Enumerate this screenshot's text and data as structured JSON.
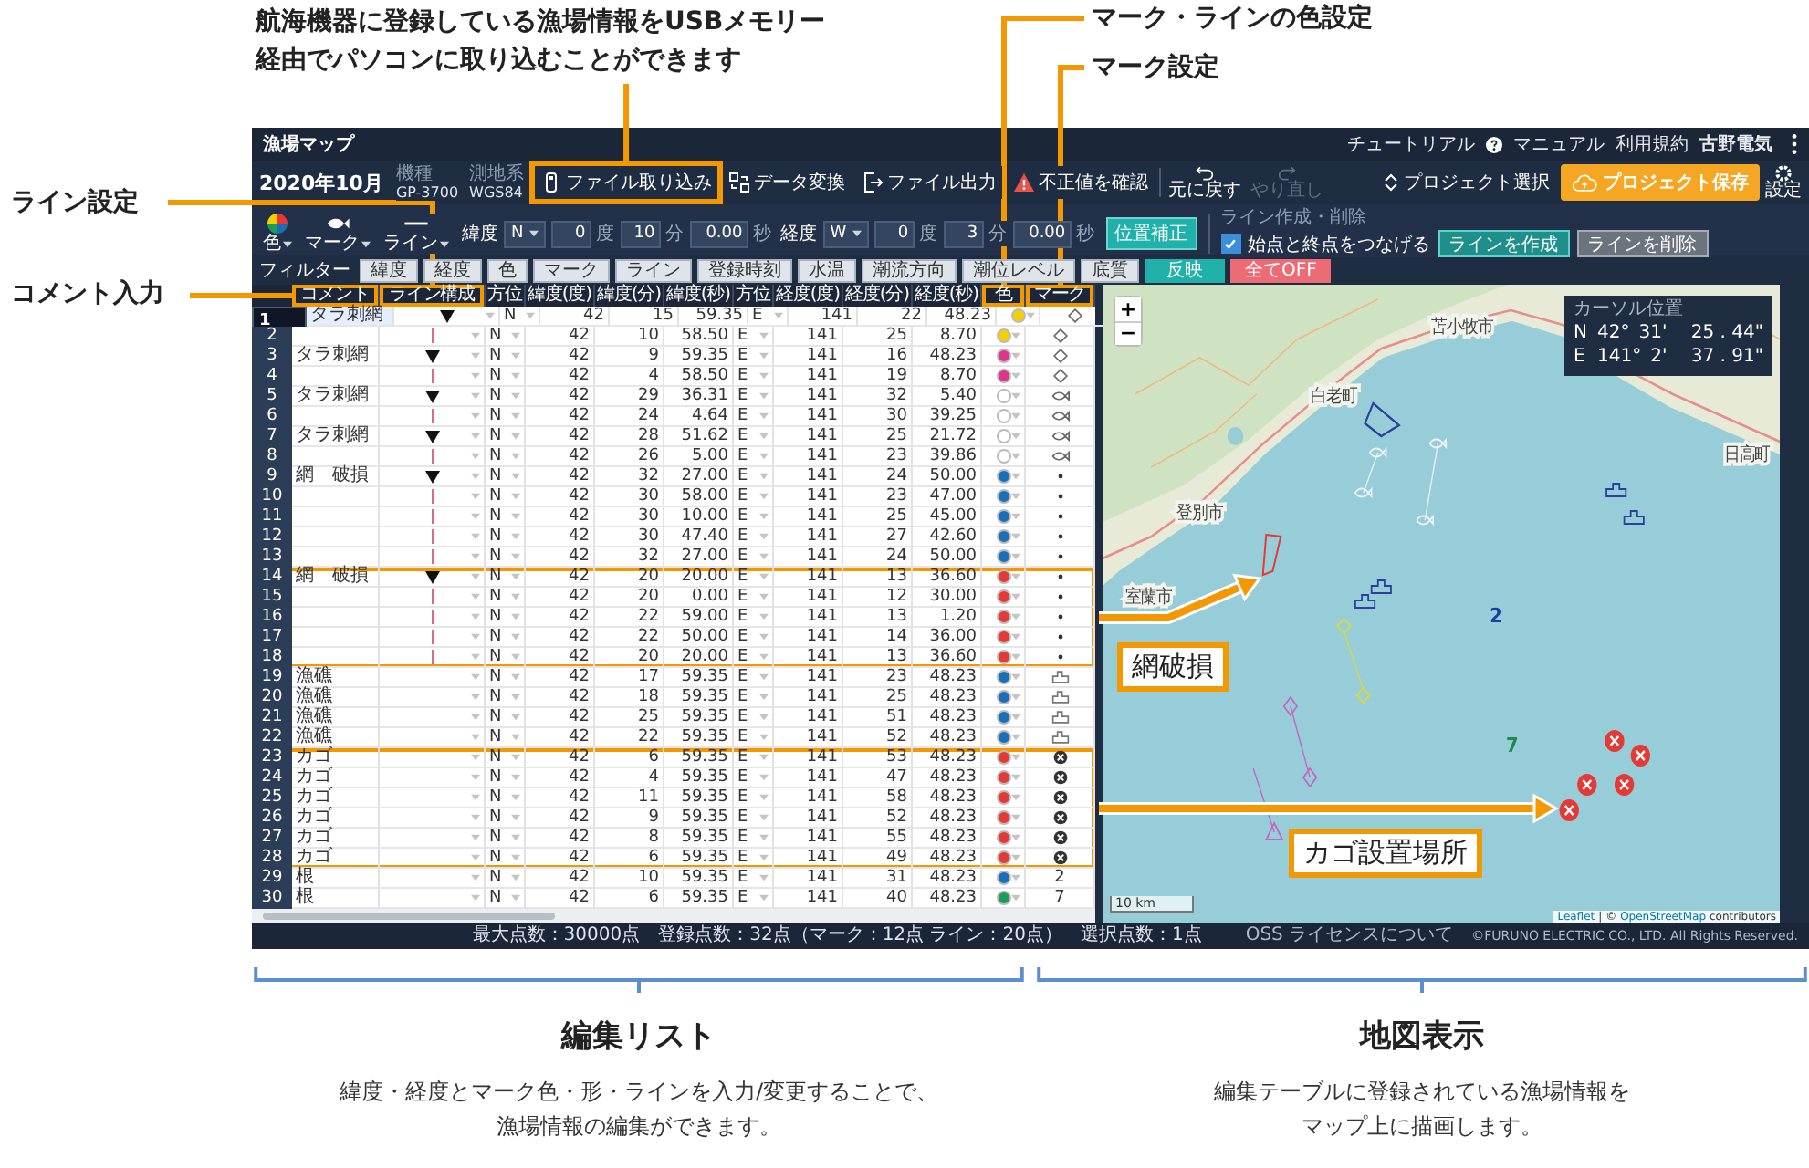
{
  "title_bar": {
    "title": "漁場マップ",
    "links": [
      {
        "label": "チュートリアル",
        "kind": "text"
      },
      {
        "label": "マニュアル",
        "kind": "help"
      },
      {
        "label": "利用規約",
        "kind": "text"
      },
      {
        "label": "古野電気",
        "kind": "user"
      }
    ]
  },
  "toolbar": {
    "date": "2020年10月",
    "specs": [
      {
        "label": "機種",
        "value": "GP-3700"
      },
      {
        "label": "測地系",
        "value": "WGS84"
      }
    ],
    "actions": [
      {
        "label": "ファイル取り込み",
        "kind": "usb",
        "callout": [
          "航海機器に登録している漁場情報をUSBメモリー",
          "経由でパソコンに取り込むことができます"
        ]
      },
      {
        "label": "データ変換",
        "kind": "convert"
      },
      {
        "label": "ファイル出力",
        "kind": "export"
      },
      {
        "label": "不正値を確認",
        "kind": "warning"
      }
    ],
    "history": [
      {
        "label": "元に戻す",
        "kind": "undo",
        "disabled": false
      },
      {
        "label": "やり直し",
        "kind": "redo",
        "disabled": true
      }
    ],
    "project_select": "プロジェクト選択",
    "project_save": "プロジェクト保存",
    "settings": "設定"
  },
  "controls": {
    "styles": [
      {
        "label": "色",
        "kind": "color"
      },
      {
        "label": "マーク",
        "kind": "mark"
      },
      {
        "label": "ライン",
        "kind": "line"
      }
    ],
    "latitude": {
      "label": "緯度",
      "dir": "N",
      "fields": [
        {
          "value": "0",
          "unit": "度"
        },
        {
          "value": "10",
          "unit": "分"
        },
        {
          "value": "0.00",
          "unit": "秒"
        }
      ]
    },
    "longitude": {
      "label": "経度",
      "dir": "W",
      "fields": [
        {
          "value": "0",
          "unit": "度"
        },
        {
          "value": "3",
          "unit": "分"
        },
        {
          "value": "0.00",
          "unit": "秒"
        }
      ]
    },
    "apply": "位置補正",
    "line_tools": {
      "title": "ライン作成・削除",
      "connect": {
        "label": "始点と終点をつなげる",
        "checked": true
      },
      "create": "ラインを作成",
      "delete": "ラインを削除"
    }
  },
  "filter": {
    "label": "フィルター",
    "items": [
      "緯度",
      "経度",
      "色",
      "マーク",
      "ライン",
      "登録時刻",
      "水温",
      "潮流方向",
      "潮位レベル",
      "底質"
    ],
    "apply": "反映",
    "all_off": "全てOFF"
  },
  "table": {
    "columns": [
      {
        "label": "コメント",
        "callout": {
          "text": "コメント入力",
          "kind": "left"
        }
      },
      {
        "label": "ライン構成",
        "callout": {
          "text": "ライン設定",
          "kind": "left"
        }
      },
      {
        "label": "方位"
      },
      {
        "label": "緯度(度)"
      },
      {
        "label": "緯度(分)"
      },
      {
        "label": "緯度(秒)"
      },
      {
        "label": "方位"
      },
      {
        "label": "経度(度)"
      },
      {
        "label": "経度(分)"
      },
      {
        "label": "経度(秒)"
      },
      {
        "label": "色",
        "callout": {
          "text": "マーク・ラインの色設定",
          "kind": "top"
        }
      },
      {
        "label": "マーク",
        "callout": {
          "text": "マーク設定",
          "kind": "top"
        }
      }
    ],
    "rows": [
      {
        "no": "1",
        "comment": "タラ刺網",
        "line": {
          "kind": "start"
        },
        "lat_dir": "N",
        "lat_deg": "42",
        "lat_min": "15",
        "lat_sec": "59.35",
        "lon_dir": "E",
        "lon_deg": "141",
        "lon_min": "22",
        "lon_sec": "48.23",
        "color": "#f5d000",
        "mark": {
          "kind": "diamond"
        },
        "selected": true,
        "highlighted": false
      },
      {
        "no": "2",
        "line": {
          "kind": "continue"
        },
        "lat_dir": "N",
        "lat_deg": "42",
        "lat_min": "10",
        "lat_sec": "58.50",
        "lon_dir": "E",
        "lon_deg": "141",
        "lon_min": "25",
        "lon_sec": "8.70",
        "color": "#f5d000",
        "mark": {
          "kind": "diamond"
        },
        "selected": false,
        "highlighted": false
      },
      {
        "no": "3",
        "comment": "タラ刺網",
        "line": {
          "kind": "start"
        },
        "lat_dir": "N",
        "lat_deg": "42",
        "lat_min": "9",
        "lat_sec": "59.35",
        "lon_dir": "E",
        "lon_deg": "141",
        "lon_min": "16",
        "lon_sec": "48.23",
        "color": "#e0338a",
        "mark": {
          "kind": "diamond"
        },
        "selected": false,
        "highlighted": false
      },
      {
        "no": "4",
        "line": {
          "kind": "continue"
        },
        "lat_dir": "N",
        "lat_deg": "42",
        "lat_min": "4",
        "lat_sec": "58.50",
        "lon_dir": "E",
        "lon_deg": "141",
        "lon_min": "19",
        "lon_sec": "8.70",
        "color": "#e0338a",
        "mark": {
          "kind": "diamond"
        },
        "selected": false,
        "highlighted": false
      },
      {
        "no": "5",
        "comment": "タラ刺網",
        "line": {
          "kind": "start"
        },
        "lat_dir": "N",
        "lat_deg": "42",
        "lat_min": "29",
        "lat_sec": "36.31",
        "lon_dir": "E",
        "lon_deg": "141",
        "lon_min": "32",
        "lon_sec": "5.40",
        "color": "#ffffff",
        "mark": {
          "kind": "fish"
        },
        "selected": false,
        "highlighted": false
      },
      {
        "no": "6",
        "line": {
          "kind": "continue"
        },
        "lat_dir": "N",
        "lat_deg": "42",
        "lat_min": "24",
        "lat_sec": "4.64",
        "lon_dir": "E",
        "lon_deg": "141",
        "lon_min": "30",
        "lon_sec": "39.25",
        "color": "#ffffff",
        "mark": {
          "kind": "fish"
        },
        "selected": false,
        "highlighted": false
      },
      {
        "no": "7",
        "comment": "タラ刺網",
        "line": {
          "kind": "start"
        },
        "lat_dir": "N",
        "lat_deg": "42",
        "lat_min": "28",
        "lat_sec": "51.62",
        "lon_dir": "E",
        "lon_deg": "141",
        "lon_min": "25",
        "lon_sec": "21.72",
        "color": "#ffffff",
        "mark": {
          "kind": "fish"
        },
        "selected": false,
        "highlighted": false
      },
      {
        "no": "8",
        "line": {
          "kind": "continue"
        },
        "lat_dir": "N",
        "lat_deg": "42",
        "lat_min": "26",
        "lat_sec": "5.00",
        "lon_dir": "E",
        "lon_deg": "141",
        "lon_min": "23",
        "lon_sec": "39.86",
        "color": "#ffffff",
        "mark": {
          "kind": "fish"
        },
        "selected": false,
        "highlighted": false
      },
      {
        "no": "9",
        "comment": "網　破損",
        "line": {
          "kind": "start"
        },
        "lat_dir": "N",
        "lat_deg": "42",
        "lat_min": "32",
        "lat_sec": "27.00",
        "lon_dir": "E",
        "lon_deg": "141",
        "lon_min": "24",
        "lon_sec": "50.00",
        "color": "#1a6fb8",
        "mark": {
          "kind": "dot"
        },
        "selected": false,
        "highlighted": false
      },
      {
        "no": "10",
        "line": {
          "kind": "continue"
        },
        "lat_dir": "N",
        "lat_deg": "42",
        "lat_min": "30",
        "lat_sec": "58.00",
        "lon_dir": "E",
        "lon_deg": "141",
        "lon_min": "23",
        "lon_sec": "47.00",
        "color": "#1a6fb8",
        "mark": {
          "kind": "dot"
        },
        "selected": false,
        "highlighted": false
      },
      {
        "no": "11",
        "line": {
          "kind": "continue"
        },
        "lat_dir": "N",
        "lat_deg": "42",
        "lat_min": "30",
        "lat_sec": "10.00",
        "lon_dir": "E",
        "lon_deg": "141",
        "lon_min": "25",
        "lon_sec": "45.00",
        "color": "#1a6fb8",
        "mark": {
          "kind": "dot"
        },
        "selected": false,
        "highlighted": false
      },
      {
        "no": "12",
        "line": {
          "kind": "continue"
        },
        "lat_dir": "N",
        "lat_deg": "42",
        "lat_min": "30",
        "lat_sec": "47.40",
        "lon_dir": "E",
        "lon_deg": "141",
        "lon_min": "27",
        "lon_sec": "42.60",
        "color": "#1a6fb8",
        "mark": {
          "kind": "dot"
        },
        "selected": false,
        "highlighted": false
      },
      {
        "no": "13",
        "line": {
          "kind": "continue"
        },
        "lat_dir": "N",
        "lat_deg": "42",
        "lat_min": "32",
        "lat_sec": "27.00",
        "lon_dir": "E",
        "lon_deg": "141",
        "lon_min": "24",
        "lon_sec": "50.00",
        "color": "#1a6fb8",
        "mark": {
          "kind": "dot"
        },
        "selected": false,
        "highlighted": false
      },
      {
        "no": "14",
        "comment": "網　破損",
        "line": {
          "kind": "start"
        },
        "lat_dir": "N",
        "lat_deg": "42",
        "lat_min": "20",
        "lat_sec": "20.00",
        "lon_dir": "E",
        "lon_deg": "141",
        "lon_min": "13",
        "lon_sec": "36.60",
        "color": "#e53935",
        "mark": {
          "kind": "dot"
        },
        "selected": false,
        "highlighted": true
      },
      {
        "no": "15",
        "line": {
          "kind": "continue"
        },
        "lat_dir": "N",
        "lat_deg": "42",
        "lat_min": "20",
        "lat_sec": "0.00",
        "lon_dir": "E",
        "lon_deg": "141",
        "lon_min": "12",
        "lon_sec": "30.00",
        "color": "#e53935",
        "mark": {
          "kind": "dot"
        },
        "selected": false,
        "highlighted": true
      },
      {
        "no": "16",
        "line": {
          "kind": "continue"
        },
        "lat_dir": "N",
        "lat_deg": "42",
        "lat_min": "22",
        "lat_sec": "59.00",
        "lon_dir": "E",
        "lon_deg": "141",
        "lon_min": "13",
        "lon_sec": "1.20",
        "color": "#e53935",
        "mark": {
          "kind": "dot"
        },
        "selected": false,
        "highlighted": true
      },
      {
        "no": "17",
        "line": {
          "kind": "continue"
        },
        "lat_dir": "N",
        "lat_deg": "42",
        "lat_min": "22",
        "lat_sec": "50.00",
        "lon_dir": "E",
        "lon_deg": "141",
        "lon_min": "14",
        "lon_sec": "36.00",
        "color": "#e53935",
        "mark": {
          "kind": "dot"
        },
        "selected": false,
        "highlighted": true
      },
      {
        "no": "18",
        "line": {
          "kind": "continue"
        },
        "lat_dir": "N",
        "lat_deg": "42",
        "lat_min": "20",
        "lat_sec": "20.00",
        "lon_dir": "E",
        "lon_deg": "141",
        "lon_min": "13",
        "lon_sec": "36.60",
        "color": "#e53935",
        "mark": {
          "kind": "dot"
        },
        "selected": false,
        "highlighted": true
      },
      {
        "no": "19",
        "comment": "漁礁",
        "lat_dir": "N",
        "lat_deg": "42",
        "lat_min": "17",
        "lat_sec": "59.35",
        "lon_dir": "E",
        "lon_deg": "141",
        "lon_min": "23",
        "lon_sec": "48.23",
        "color": "#1a6fb8",
        "mark": {
          "kind": "boat"
        },
        "selected": false,
        "highlighted": false
      },
      {
        "no": "20",
        "comment": "漁礁",
        "lat_dir": "N",
        "lat_deg": "42",
        "lat_min": "18",
        "lat_sec": "59.35",
        "lon_dir": "E",
        "lon_deg": "141",
        "lon_min": "25",
        "lon_sec": "48.23",
        "color": "#1a6fb8",
        "mark": {
          "kind": "boat"
        },
        "selected": false,
        "highlighted": false
      },
      {
        "no": "21",
        "comment": "漁礁",
        "lat_dir": "N",
        "lat_deg": "42",
        "lat_min": "25",
        "lat_sec": "59.35",
        "lon_dir": "E",
        "lon_deg": "141",
        "lon_min": "51",
        "lon_sec": "48.23",
        "color": "#1a6fb8",
        "mark": {
          "kind": "boat"
        },
        "selected": false,
        "highlighted": false
      },
      {
        "no": "22",
        "comment": "漁礁",
        "lat_dir": "N",
        "lat_deg": "42",
        "lat_min": "22",
        "lat_sec": "59.35",
        "lon_dir": "E",
        "lon_deg": "141",
        "lon_min": "52",
        "lon_sec": "48.23",
        "color": "#1a6fb8",
        "mark": {
          "kind": "boat"
        },
        "selected": false,
        "highlighted": false
      },
      {
        "no": "23",
        "comment": "カゴ",
        "lat_dir": "N",
        "lat_deg": "42",
        "lat_min": "6",
        "lat_sec": "59.35",
        "lon_dir": "E",
        "lon_deg": "141",
        "lon_min": "53",
        "lon_sec": "48.23",
        "color": "#e53935",
        "mark": {
          "kind": "cross"
        },
        "selected": false,
        "highlighted": true
      },
      {
        "no": "24",
        "comment": "カゴ",
        "lat_dir": "N",
        "lat_deg": "42",
        "lat_min": "4",
        "lat_sec": "59.35",
        "lon_dir": "E",
        "lon_deg": "141",
        "lon_min": "47",
        "lon_sec": "48.23",
        "color": "#e53935",
        "mark": {
          "kind": "cross"
        },
        "selected": false,
        "highlighted": true
      },
      {
        "no": "25",
        "comment": "カゴ",
        "lat_dir": "N",
        "lat_deg": "42",
        "lat_min": "11",
        "lat_sec": "59.35",
        "lon_dir": "E",
        "lon_deg": "141",
        "lon_min": "58",
        "lon_sec": "48.23",
        "color": "#e53935",
        "mark": {
          "kind": "cross"
        },
        "selected": false,
        "highlighted": true
      },
      {
        "no": "26",
        "comment": "カゴ",
        "lat_dir": "N",
        "lat_deg": "42",
        "lat_min": "9",
        "lat_sec": "59.35",
        "lon_dir": "E",
        "lon_deg": "141",
        "lon_min": "52",
        "lon_sec": "48.23",
        "color": "#e53935",
        "mark": {
          "kind": "cross"
        },
        "selected": false,
        "highlighted": true
      },
      {
        "no": "27",
        "comment": "カゴ",
        "lat_dir": "N",
        "lat_deg": "42",
        "lat_min": "8",
        "lat_sec": "59.35",
        "lon_dir": "E",
        "lon_deg": "141",
        "lon_min": "55",
        "lon_sec": "48.23",
        "color": "#e53935",
        "mark": {
          "kind": "cross"
        },
        "selected": false,
        "highlighted": true
      },
      {
        "no": "28",
        "comment": "カゴ",
        "lat_dir": "N",
        "lat_deg": "42",
        "lat_min": "6",
        "lat_sec": "59.35",
        "lon_dir": "E",
        "lon_deg": "141",
        "lon_min": "49",
        "lon_sec": "48.23",
        "color": "#e53935",
        "mark": {
          "kind": "cross"
        },
        "selected": false,
        "highlighted": true
      },
      {
        "no": "29",
        "comment": "根",
        "lat_dir": "N",
        "lat_deg": "42",
        "lat_min": "10",
        "lat_sec": "59.35",
        "lon_dir": "E",
        "lon_deg": "141",
        "lon_min": "31",
        "lon_sec": "48.23",
        "color": "#1a6fb8",
        "mark": {
          "kind": "number",
          "label": "2"
        },
        "selected": false,
        "highlighted": false
      },
      {
        "no": "30",
        "comment": "根",
        "lat_dir": "N",
        "lat_deg": "42",
        "lat_min": "6",
        "lat_sec": "59.35",
        "lon_dir": "E",
        "lon_deg": "141",
        "lon_min": "40",
        "lon_sec": "48.23",
        "color": "#1e9a5a",
        "mark": {
          "kind": "number",
          "label": "7"
        },
        "selected": false,
        "highlighted": false
      }
    ],
    "highlight_labels": [
      "網破損",
      "カゴ設置場所"
    ]
  },
  "map": {
    "zoom_in": "+",
    "zoom_out": "−",
    "place_names": [
      "苫小牧市",
      "白老町",
      "登別市",
      "室蘭市",
      "日高町"
    ],
    "marker_labels": [
      {
        "text": "2",
        "color": "#1a3fa0"
      },
      {
        "text": "7",
        "color": "#1e8a4a"
      }
    ],
    "cursor": {
      "title": "カーソル位置",
      "rows": [
        {
          "dir": "N",
          "deg": "42°",
          "min": "31'",
          "sec": "25 . 44\""
        },
        {
          "dir": "E",
          "deg": "141°",
          "min": "2'",
          "sec": "37 . 91\""
        }
      ]
    },
    "scale": "10 km",
    "attribution": {
      "leaflet": "Leaflet",
      "middle": "| ©",
      "osm": "OpenStreetMap",
      "suffix": "contributors"
    }
  },
  "status_bar": {
    "items": [
      "最大点数：30000点",
      "登録点数：32点（マーク：12点 ライン：20点）",
      "選択点数：1点"
    ],
    "license": "OSS ライセンスについて",
    "copyright": "©FURUNO ELECTRIC CO., LTD. All Rights Reserved."
  },
  "captions": [
    {
      "title": "編集リスト",
      "lines": [
        "緯度・経度とマーク色・形・ラインを入力/変更することで、",
        "漁場情報の編集ができます。"
      ]
    },
    {
      "title": "地図表示",
      "lines": [
        "編集テーブルに登録されている漁場情報を",
        "マップ上に描画します。"
      ]
    }
  ]
}
